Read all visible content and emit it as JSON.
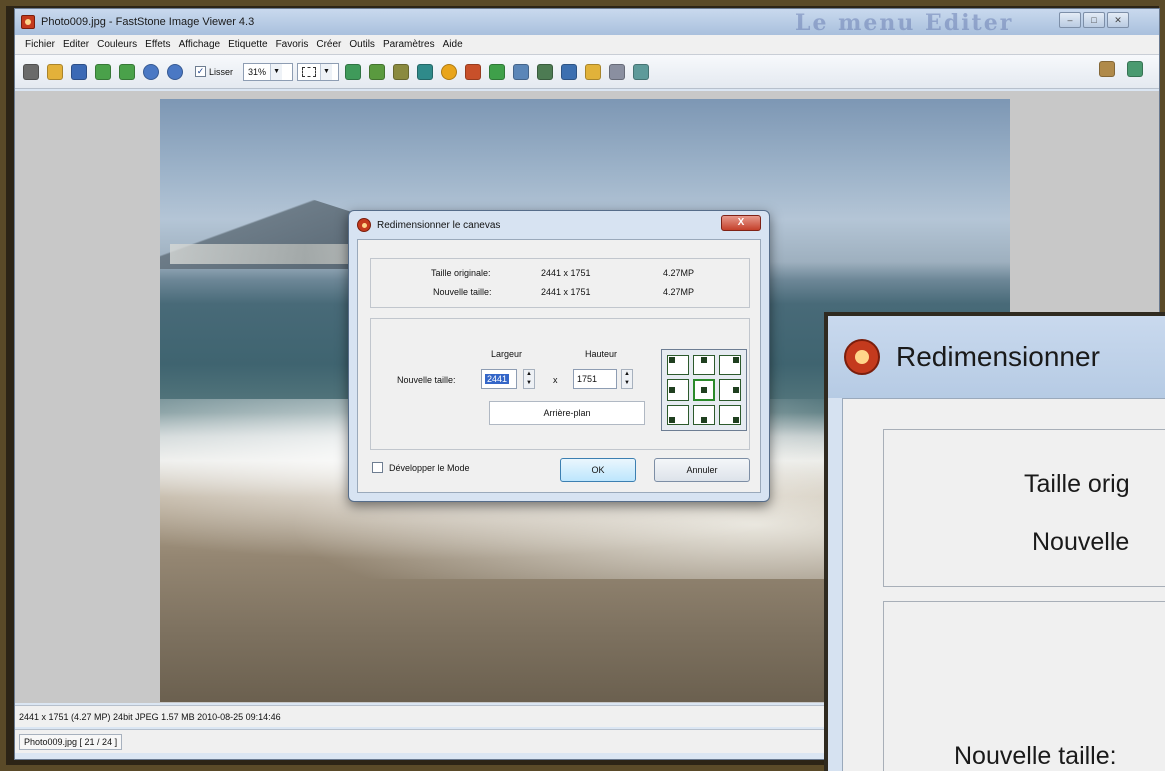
{
  "window": {
    "title": "Photo009.jpg  -  FastStone Image Viewer 4.3",
    "watermark": "Le menu   Editer"
  },
  "menu": [
    "Fichier",
    "Editer",
    "Couleurs",
    "Effets",
    "Affichage",
    "Etiquette",
    "Favoris",
    "Créer",
    "Outils",
    "Paramètres",
    "Aide"
  ],
  "toolbar": {
    "smooth_label": "Lisser",
    "smooth_checked": true,
    "zoom_value": "31%"
  },
  "status": {
    "info": "2441 x 1751 (4.27 MP)   24bit JPEG   1.57 MB   2010-08-25 09:14:46",
    "file": "Photo009.jpg [ 21 / 24 ]"
  },
  "dialog": {
    "title": "Redimensionner le canevas",
    "close": "X",
    "original_label": "Taille originale:",
    "original_dims": "2441 x 1751",
    "original_mp": "4.27MP",
    "new_label": "Nouvelle taille:",
    "new_dims": "2441 x 1751",
    "new_mp": "4.27MP",
    "width_header": "Largeur",
    "height_header": "Hauteur",
    "size_label": "Nouvelle taille:",
    "width_value": "2441",
    "times": "x",
    "height_value": "1751",
    "background_button": "Arrière-plan",
    "expand_mode_label": "Développer le Mode",
    "ok": "OK",
    "cancel": "Annuler"
  },
  "zoom": {
    "title": "Redimensionner",
    "line1": "Taille orig",
    "line2": "Nouvelle",
    "line3": "Nouvelle taille:"
  },
  "colors": {
    "frame": "#5a4a28",
    "title_bar": "#b6cbe4",
    "accent_ok": "#3c7fb1"
  }
}
